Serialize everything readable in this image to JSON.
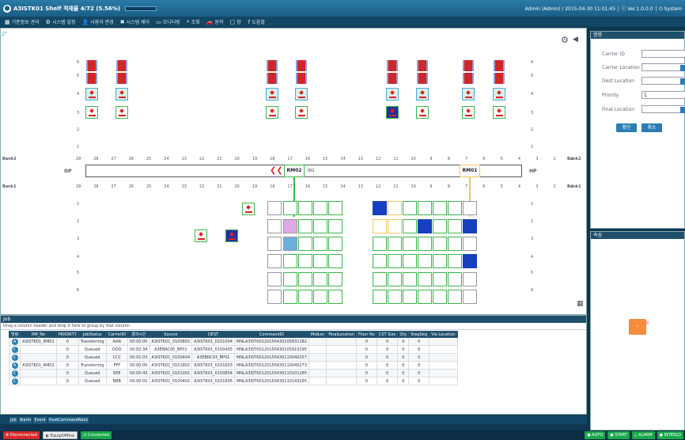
{
  "title": {
    "name": "A3ISTK01 Shelf 적재율 4/72 (5.56%)",
    "right": "Admin (Admin) / 2015-04-30 11:01:45 │ ⓘ Ver.1.0.0.0 │ ⏻ System"
  },
  "menu": [
    {
      "icon": "grid-icon",
      "label": "기준정보 관리"
    },
    {
      "icon": "gear-icon",
      "label": "시스템 설정"
    },
    {
      "icon": "user-icon",
      "label": "사용자 변경"
    },
    {
      "icon": "wrench-icon",
      "label": "시스템 제어"
    },
    {
      "icon": "monitor-icon",
      "label": "모니터링"
    },
    {
      "icon": "search-icon",
      "label": "조회"
    },
    {
      "icon": "car-icon",
      "label": "동작"
    },
    {
      "icon": "window-icon",
      "label": "창"
    },
    {
      "icon": "help-icon",
      "label": "도움말"
    }
  ],
  "map": {
    "bank2_label": "Bank2",
    "bank1_label": "Bank1",
    "op": "OP",
    "hp": "HP",
    "bay_numbers": [
      "29",
      "28",
      "27",
      "26",
      "25",
      "24",
      "23",
      "22",
      "21",
      "20",
      "19",
      "18",
      "17",
      "16",
      "15",
      "14",
      "13",
      "12",
      "11",
      "10",
      "9",
      "8",
      "7",
      "6",
      "5",
      "4",
      "3",
      "2",
      "1"
    ],
    "levels": [
      "6",
      "5",
      "4",
      "3",
      "2",
      "1"
    ],
    "rm02": "RM02",
    "rm01": "RM01",
    "id1": "ID1"
  },
  "form": {
    "header": "명령",
    "carrier_id": "Carrier ID",
    "carrier_location": "Carrier Location",
    "dest_location": "Dest Location",
    "priority": "Priority",
    "priority_value": "1",
    "final_location": "Final Location",
    "ok": "확인",
    "cancel": "취소"
  },
  "attr": {
    "header": "속성"
  },
  "job": {
    "header": "Job",
    "drag_hint": "Drag a column header and drop it here to group by that column",
    "columns": [
      "명령",
      "RM_No",
      "PRIORITY",
      "JobStatus",
      "CarrierID",
      "경과시간",
      "Source",
      "DEST",
      "CommandID",
      "MidLoc",
      "FinalLocation",
      "Floor No",
      "CST Size",
      "Qty",
      "StepSeq",
      "Via Location"
    ],
    "rows": [
      {
        "st": "A",
        "rm": "A3ISTK01_RM01",
        "pri": "0",
        "status": "Transferring",
        "carrier": "AAA",
        "time": "00:00:00",
        "src": "A3ISTK01_0100802",
        "dest": "A3ISTK01_0101004",
        "cmd": "MNLA3ISTK0120150430105831182",
        "f": "0",
        "c": "0",
        "q": "0",
        "s": "0"
      },
      {
        "st": "C",
        "rm": "",
        "pri": "0",
        "status": "Queued",
        "carrier": "DDD",
        "time": "00:02:34",
        "src": "A3EBRC05_BP01",
        "dest": "A3ISTK01_0100405",
        "cmd": "MNLA3ISTK0120150430105910195",
        "f": "0",
        "c": "0",
        "q": "0",
        "s": "0"
      },
      {
        "st": "C",
        "rm": "",
        "pri": "0",
        "status": "Queued",
        "carrier": "CCC",
        "time": "00:01:03",
        "src": "A3ISTK01_0100404",
        "dest": "A3EBRC03_BP01",
        "cmd": "MNLA3ISTK0120150430110040257",
        "f": "0",
        "c": "0",
        "q": "0",
        "s": "0"
      },
      {
        "st": "A",
        "rm": "A3ISTK01_RM02",
        "pri": "0",
        "status": "Transferring",
        "carrier": "FFF",
        "time": "00:00:00",
        "src": "A3ISTK01_0101802",
        "dest": "A3ISTK01_0101603",
        "cmd": "MNLA3ISTK0120150430110040273",
        "f": "0",
        "c": "0",
        "q": "0",
        "s": "0"
      },
      {
        "st": "C",
        "rm": "",
        "pri": "0",
        "status": "Queued",
        "carrier": "EEE",
        "time": "00:00:43",
        "src": "A3ISTK01_0101001",
        "dest": "A3ISTK01_0100804",
        "cmd": "MNLA3ISTK0120150430110101285",
        "f": "0",
        "c": "0",
        "q": "0",
        "s": "0"
      },
      {
        "st": "C",
        "rm": "",
        "pri": "0",
        "status": "Queued",
        "carrier": "BBB",
        "time": "00:00:01",
        "src": "A3ISTK01_0100402",
        "dest": "A3ISTK01_0101605",
        "cmd": "MNLA3ISTK0120150430110143295",
        "f": "0",
        "c": "0",
        "q": "0",
        "s": "0"
      }
    ]
  },
  "tabs": [
    "Job",
    "Alarm",
    "Event",
    "HostCommandNack"
  ],
  "status": {
    "disconnected": "Disconnected",
    "equip": "EquipOffline",
    "connected": "Connected",
    "auto": "AUTO",
    "start": "START",
    "alarm": "ALARM",
    "interlock": "INTERLO"
  },
  "colors": {
    "accent": "#2b7db3",
    "ok": "#18a84a",
    "err": "#d62b2b",
    "shelf_green": "#3cb64a",
    "shelf_blue": "#1740c0"
  }
}
